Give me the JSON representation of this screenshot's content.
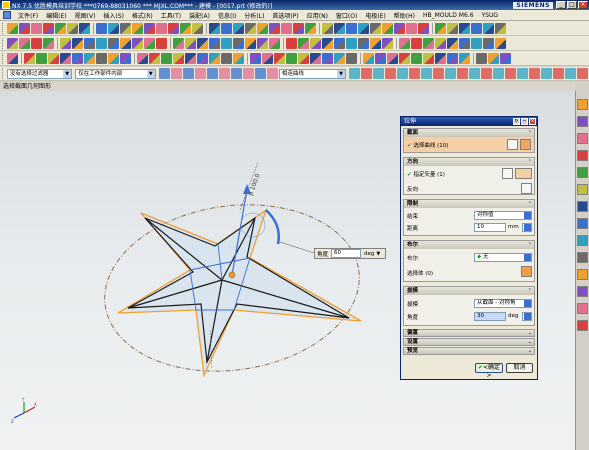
{
  "window": {
    "title": "NX 7.5 优胜模具培训学校 ***0769-88031060 *** MJXL.COM*** - 建模 - [0017.prt (修改的)]",
    "brand": "SIEMENS",
    "btn_min": "_",
    "btn_max": "□",
    "btn_close": "×"
  },
  "menu": {
    "items": [
      "文件(F)",
      "编辑(E)",
      "视图(V)",
      "插入(S)",
      "格式(R)",
      "工具(T)",
      "装配(A)",
      "信息(I)",
      "分析(L)",
      "首选项(P)",
      "应用(N)",
      "窗口(O)",
      "电极(E)",
      "帮助(H)",
      "HB_MOULD M6.6",
      "YSUG"
    ]
  },
  "selection_bar": {
    "filter_label": "没有选择过滤器",
    "scope_label": "仅在工作部件内部",
    "curve_rule_label": "相连曲线"
  },
  "status": {
    "prompt": "选择截面几何图形"
  },
  "viewport": {
    "dim_height_label": "p 100.0",
    "angle_label": "角度",
    "angle_value": "60",
    "angle_unit": "deg"
  },
  "dialog": {
    "title": "拉伸",
    "section": {
      "header": "截面",
      "select_curve": "选择曲线 (10)"
    },
    "direction": {
      "header": "方向",
      "specify_vector": "指定矢量 (1)",
      "reverse": "反向"
    },
    "limits": {
      "header": "限制",
      "end_label": "结束",
      "end_value": "对称值",
      "distance_label": "距离",
      "distance_value": "10",
      "distance_unit": "mm"
    },
    "boolean": {
      "header": "布尔",
      "boolean_label": "布尔",
      "boolean_value": "无",
      "select_body": "选择体 (0)"
    },
    "draft": {
      "header": "拔模",
      "draft_label": "拔模",
      "draft_value": "从截面 - 对称角",
      "angle_label": "角度",
      "angle_value": "30",
      "angle_unit": "deg"
    },
    "offset": {
      "header": "偏置"
    },
    "settings": {
      "header": "设置"
    },
    "preview": {
      "header": "预览"
    },
    "ok": "<确定>",
    "cancel": "取消"
  },
  "colors": {
    "star_outer": "#f0a030",
    "star_inner": "#1a1a1a",
    "star_edges_blue": "#3a6fd0",
    "ellipse": "#8a7050",
    "title_bar": "#0a246a"
  }
}
